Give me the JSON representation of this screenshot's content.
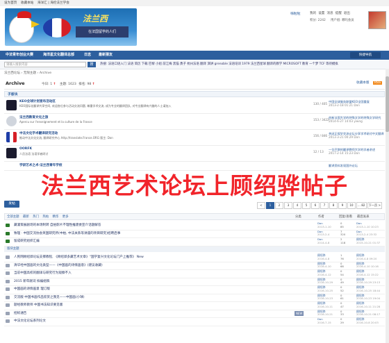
{
  "topbar": {
    "items": [
      "设为首页",
      "收藏本站",
      "海洋汇 | 海伦法兰学会"
    ]
  },
  "logo": {
    "text": "法兰西",
    "sub": "在法国留学的人们"
  },
  "user": {
    "name": "嗨啦啦",
    "links": [
      "我的",
      "设置",
      "消息",
      "提醒",
      "退出"
    ],
    "points": "积分: 2242",
    "group": "用户组: 哪吒会员"
  },
  "nav": {
    "items": [
      "中法青年创业大赛",
      "海洋星文化翻译总部",
      "日志",
      "最新猜友"
    ],
    "button": "快捷导航"
  },
  "search": {
    "placeholder": "请输入搜索内容",
    "button": "搜"
  },
  "hottags": "热搜: 法语口语入门 法语 简历 下载 巴黎 小组 前江梅 黑猫 勇子 杭州法语 翻译 演讲 grenoble 法语培训 1979 法兰西星球 翻译的教学 MICROSOFT 教育 一个梦 TCF 等待模拟",
  "breadcrumb": "法兰西论坛 › 无限主题 › Archive",
  "archive": {
    "title": "Archive",
    "today": "今日: 1",
    "topics": "主题: 1623",
    "rank": "排名: 98",
    "buttons": [
      "收藏本版",
      "RSS"
    ]
  },
  "subforum_head": "子版块",
  "forums": [
    {
      "name": "KEO全球计划宣布活动区",
      "desc": "KEO国际化翻译共享空间, 欢迎各位参与活动交流问题, 尊重学术交流, 成为专业的翻译团队, 对专业翻译有兴趣的人士请加入",
      "count": "130 / 405",
      "last": [
        "中国全球服务联盟KEO全国重复",
        "2013-2-18 01:21 Don"
      ]
    },
    {
      "name": "法兰西教育文化之旅",
      "desc": "Apercu sur l'enseignement et la culture de la France",
      "count": "153 / 3422",
      "last": [
        "创新法国大学的特殊文学的特殊文学研究",
        "2014-6-27 14:03 yiwng"
      ]
    },
    {
      "name": "中法文化学术翻译研究活动",
      "desc": "推动中法文化交流, 翻译研究中心 http://translate.France.ORG 版主: Don",
      "count": "156 / 846",
      "last": [
        "关闭正规学交流论坛分享学术研讨中文翻译",
        "2013-3-21 00:29 Don"
      ]
    },
    {
      "name": "OORFK",
      "desc": "人员法语 法语学者研讨",
      "count": "12 / 13",
      "last": [
        "一位巴黎的翻译教师大学的学者讲述",
        "2017-2-14 15:23 Don"
      ]
    },
    {
      "name": "学研艺术之术·法兰西青年学校",
      "desc": "",
      "count": "",
      "last": [
        "翻译资料发现国外论坛",
        ""
      ]
    }
  ],
  "banner": "法兰西艺术论坛上顾绍骅帖子",
  "postbar": {
    "new": "发帖",
    "pages": [
      "<",
      "1",
      "2",
      "3",
      "4",
      "5",
      "6",
      "7",
      "8",
      "9",
      "10",
      "... 82",
      "下一页 >"
    ]
  },
  "filter": {
    "items": [
      "全部主题",
      "最新",
      "热门",
      "热帖",
      "精华",
      "更多"
    ],
    "cols": [
      "分类",
      "作者",
      "回复/查看",
      "最后发表"
    ]
  },
  "threads": [
    {
      "icon": "#2a7a2a",
      "title": "藏灌策展剧场的本场制转 自拍影片不理性推建委宣介话题解答",
      "cat": "",
      "author": [
        "Don",
        "2013-1-10"
      ],
      "rep": [
        "0",
        "85"
      ],
      "last": [
        "Don",
        "2013-1-10 10:23"
      ]
    },
    {
      "icon": "#2a7a2a",
      "title": "致理 · 中国交流协会英国研究所(中柏, 中法关系等讲座的项目研究)招聘启事",
      "cat": "",
      "author": [
        "Don",
        "2013-2-4"
      ],
      "rep": [
        "7",
        "320"
      ],
      "last": [
        "Don",
        "2013-2-4 23:32"
      ]
    },
    {
      "icon": "#2a7a2a",
      "title": "留成研究组织汇编",
      "cat": "",
      "author": [
        "Don",
        "2014-4-8"
      ],
      "rep": [
        "2",
        "118"
      ],
      "last": [
        "顾绍骅",
        "2015-10-21 01:37"
      ]
    }
  ],
  "sep": "版块主题",
  "threads2": [
    {
      "icon": "#9aa3b5",
      "title": "人民网顾绍骅论坛支撑教程, 《顾绍骅多藏艺术文章》“国学复兴文化论坛门户上推荐》 New",
      "cat": "",
      "author": [
        "顾绍骅",
        "2016-4-8"
      ],
      "rep": [
        "1",
        "76"
      ],
      "last": [
        "顾绍骅",
        "2016-4-8 09:20"
      ]
    },
    {
      "icon": "#9aa3b5",
      "title": "清华经中国画的文化类型——《中国画的诗情画意》(建议收藏)",
      "cat": "",
      "author": [
        "顾绍骅",
        "2016-4-10"
      ],
      "rep": [
        "0",
        "68"
      ],
      "last": [
        "顾绍骅",
        "2016-4-10 10:16"
      ]
    },
    {
      "icon": "#9aa3b5",
      "title": "当前中国高校的翻译与研究行为观察不入",
      "cat": "",
      "author": [
        "顾绍骅",
        "2016-4-12"
      ],
      "rep": [
        "0",
        "54"
      ],
      "last": [
        "顾绍骅",
        "2016-4-12 15:22"
      ]
    },
    {
      "icon": "#9aa3b5",
      "title": "2015 新年献词 拟编组稿",
      "cat": "",
      "author": [
        "顾绍骅",
        "2016-10-29"
      ],
      "rep": [
        "0",
        "49"
      ],
      "last": [
        "顾绍骅",
        "2016-10-29 23:13"
      ]
    },
    {
      "icon": "#9aa3b5",
      "title": "中国画的诗情画意 理订版",
      "cat": "",
      "author": [
        "顾绍骅",
        "2016-10-25"
      ],
      "rep": [
        "0",
        "52"
      ],
      "last": [
        "顾绍骅",
        "2016-10-25 18:44"
      ]
    },
    {
      "icon": "#9aa3b5",
      "title": "交流版 中国书画作品欣赏之我见——中国画(小球)",
      "cat": "",
      "author": [
        "顾绍骅",
        "2016-10-23"
      ],
      "rep": [
        "0",
        "61"
      ],
      "last": [
        "顾绍骅",
        "2016-10-23 19:04"
      ]
    },
    {
      "icon": "#9aa3b5",
      "title": "题经教师教师 中国书法知识要见版",
      "cat": "",
      "author": [
        "顾绍骅",
        "2016-10-11"
      ],
      "rep": [
        "0",
        "47"
      ],
      "last": [
        "顾绍骅",
        "2016-10-11 21:28"
      ]
    },
    {
      "icon": "#9aa3b5",
      "title": "招标通告",
      "cat": "NEW",
      "author": [
        "顾绍骅",
        "2016-10-21"
      ],
      "rep": [
        "0",
        "33"
      ],
      "last": [
        "顾绍骅",
        "2016-10-21 08:17"
      ]
    },
    {
      "icon": "#9aa3b5",
      "title": "中法文化论坛系列论文",
      "cat": "",
      "author": [
        "Don",
        "2016-7-15"
      ],
      "rep": [
        "0",
        "29"
      ],
      "last": [
        "顾绍骅",
        "2016-10-8 20:03"
      ]
    }
  ]
}
